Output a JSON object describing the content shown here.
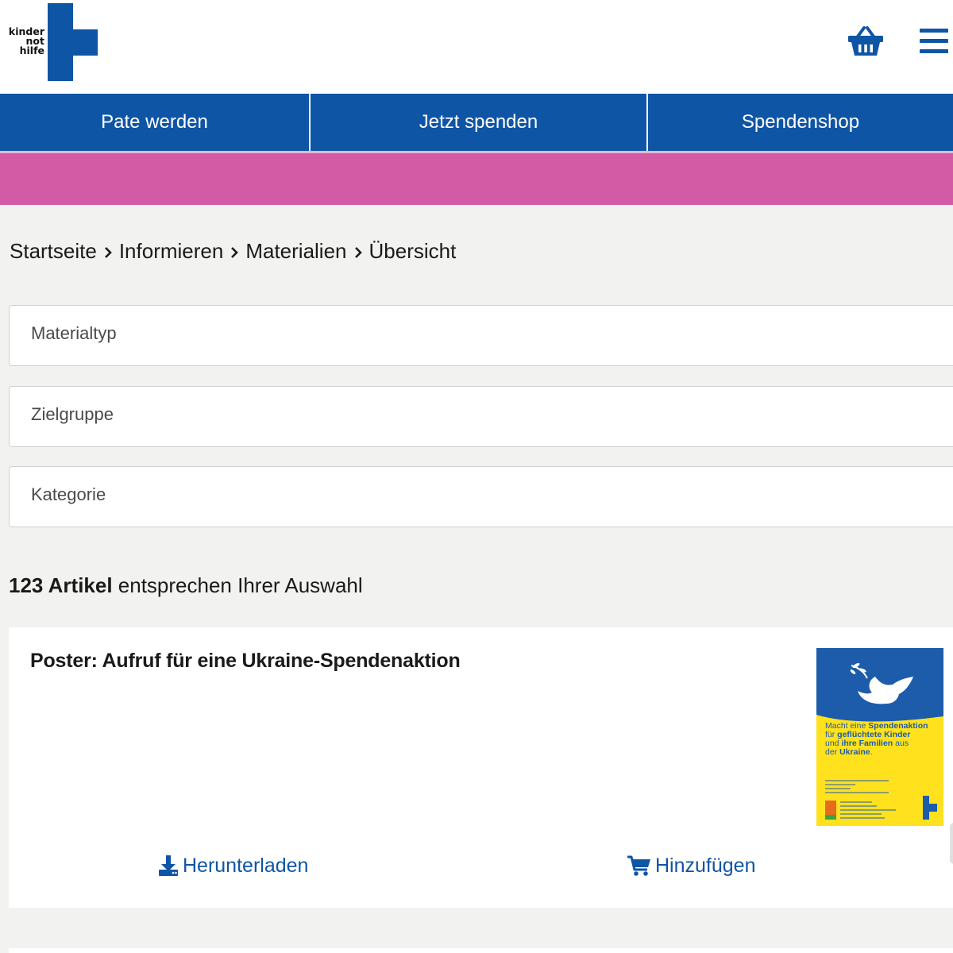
{
  "header": {
    "logo_lines": [
      "kinder",
      "not",
      "hilfe"
    ],
    "basket_icon": "shopping-basket-icon",
    "menu_icon": "hamburger-menu-icon"
  },
  "nav": {
    "items": [
      "Pate werden",
      "Jetzt spenden",
      "Spendenshop"
    ]
  },
  "breadcrumb": {
    "items": [
      "Startseite",
      "Informieren",
      "Materialien",
      "Übersicht"
    ]
  },
  "filters": {
    "material_type": "Materialtyp",
    "target_group": "Zielgruppe",
    "category": "Kategorie"
  },
  "results": {
    "count_label": "123 Artikel",
    "suffix": " entsprechen Ihrer Auswahl"
  },
  "product": {
    "title": "Poster: Aufruf für eine Ukraine-Spendenaktion",
    "download_label": "Herunterladen",
    "add_label": "Hinzufügen",
    "thumbnail_text": {
      "line1_normal": "Macht eine ",
      "line1_bold": "Spendenaktion",
      "line2_normal": "für ",
      "line2_bold": "geflüchtete Kinder",
      "line3_normal": "und ",
      "line3_bold": "ihre Familien",
      "line3_end": " aus",
      "line4_normal": "der ",
      "line4_bold": "Ukraine",
      "line4_end": "."
    }
  },
  "colors": {
    "brand_blue": "#0f55a5",
    "pink": "#d35aa5",
    "poster_yellow": "#ffe11e"
  }
}
